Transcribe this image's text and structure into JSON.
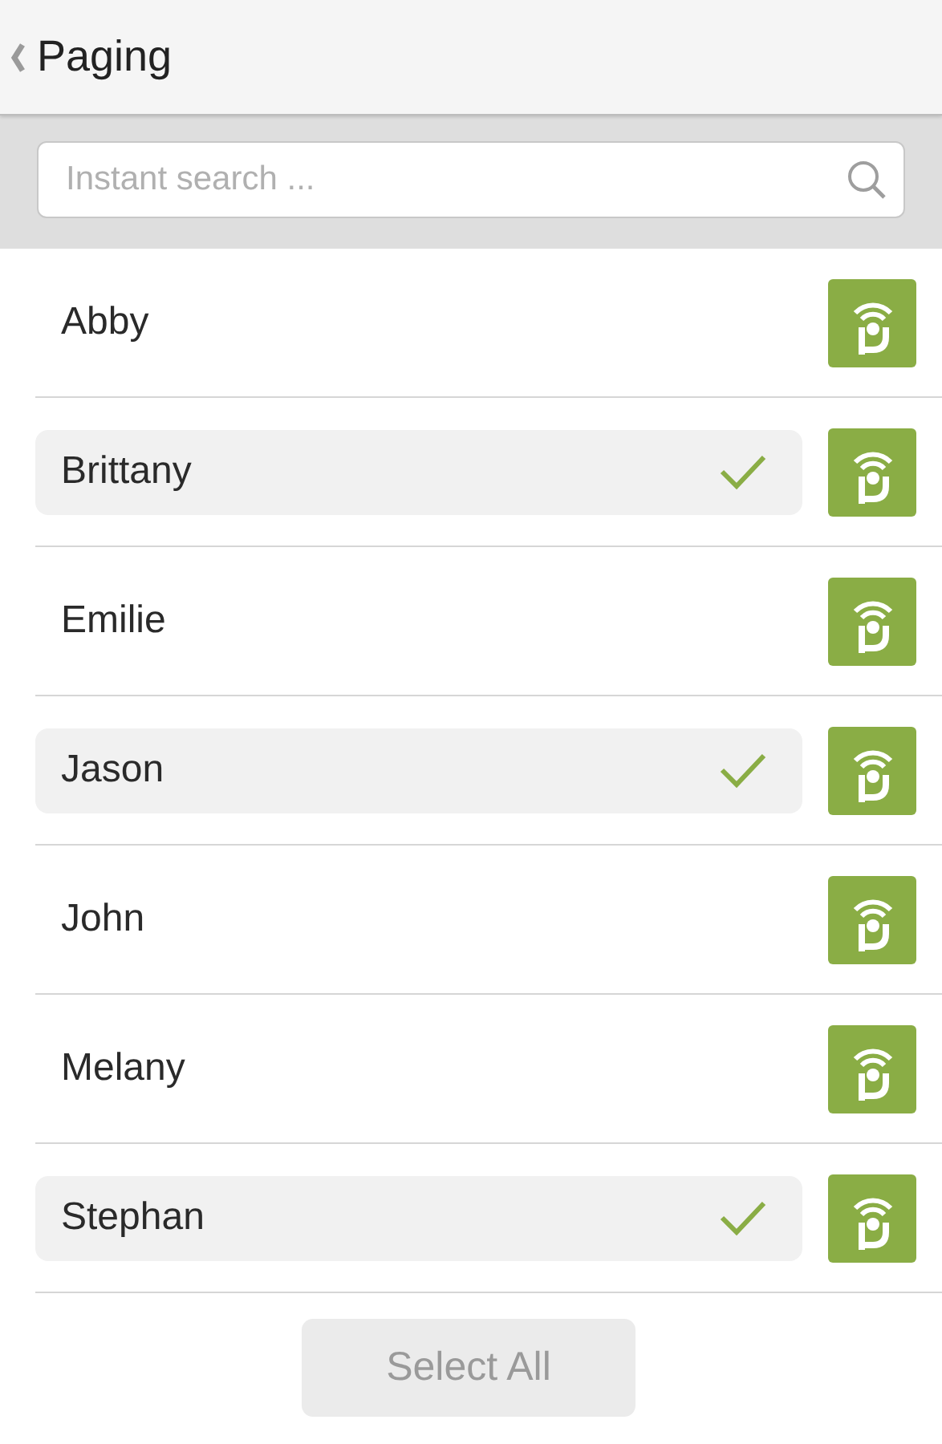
{
  "header": {
    "title": "Paging"
  },
  "search": {
    "placeholder": "Instant search ..."
  },
  "contacts": [
    {
      "name": "Abby",
      "selected": false
    },
    {
      "name": "Brittany",
      "selected": true
    },
    {
      "name": "Emilie",
      "selected": false
    },
    {
      "name": "Jason",
      "selected": true
    },
    {
      "name": "John",
      "selected": false
    },
    {
      "name": "Melany",
      "selected": false
    },
    {
      "name": "Stephan",
      "selected": true
    }
  ],
  "select_all": {
    "label": "Select All",
    "disabled": true
  }
}
